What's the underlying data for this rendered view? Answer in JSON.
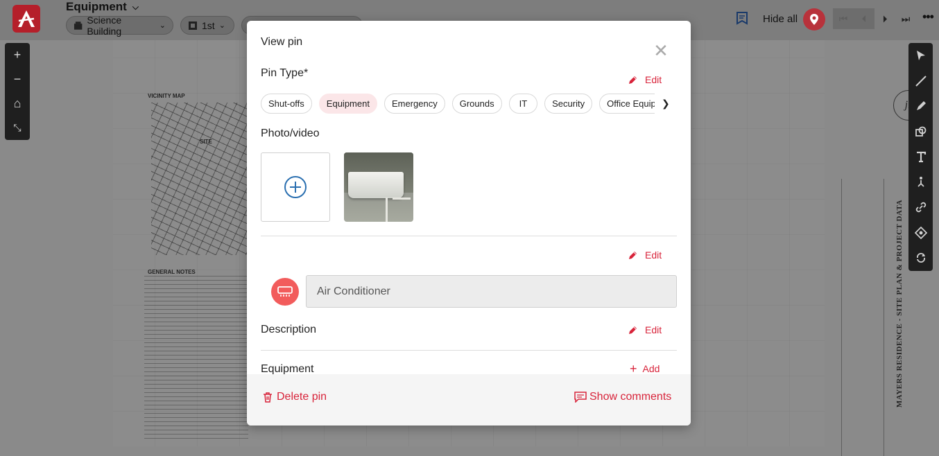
{
  "app": {
    "title": "Equipment",
    "building": "Science Building",
    "floor": "1st",
    "hide_all": "Hide all"
  },
  "drawing": {
    "vicinity_map": "VICINITY MAP",
    "site": "SITE",
    "general_notes": "GENERAL NOTES",
    "sheet_title": "MAYERS RESIDENCE - SITE PLAN & PROJECT DATA",
    "monogram": "jr"
  },
  "modal": {
    "title": "View pin",
    "pin_type_label": "Pin Type*",
    "edit_label": "Edit",
    "pin_types": [
      "Shut-offs",
      "Equipment",
      "Emergency",
      "Grounds",
      "IT",
      "Security",
      "Office Equipment"
    ],
    "selected_pin_type": "Equipment",
    "photo_label": "Photo/video",
    "pin_name": "Air Conditioner",
    "description_label": "Description",
    "equipment_label": "Equipment",
    "add_label": "Add",
    "delete_label": "Delete pin",
    "comments_label": "Show comments"
  },
  "colors": {
    "accent": "#d8233a",
    "chip_selected_bg": "#fbe6e8",
    "category_icon_bg": "#f25c5c",
    "logo_bg": "#b51f2a"
  },
  "icons": {
    "pin_category": "air-conditioner-icon",
    "add_media": "plus-circle-icon"
  }
}
